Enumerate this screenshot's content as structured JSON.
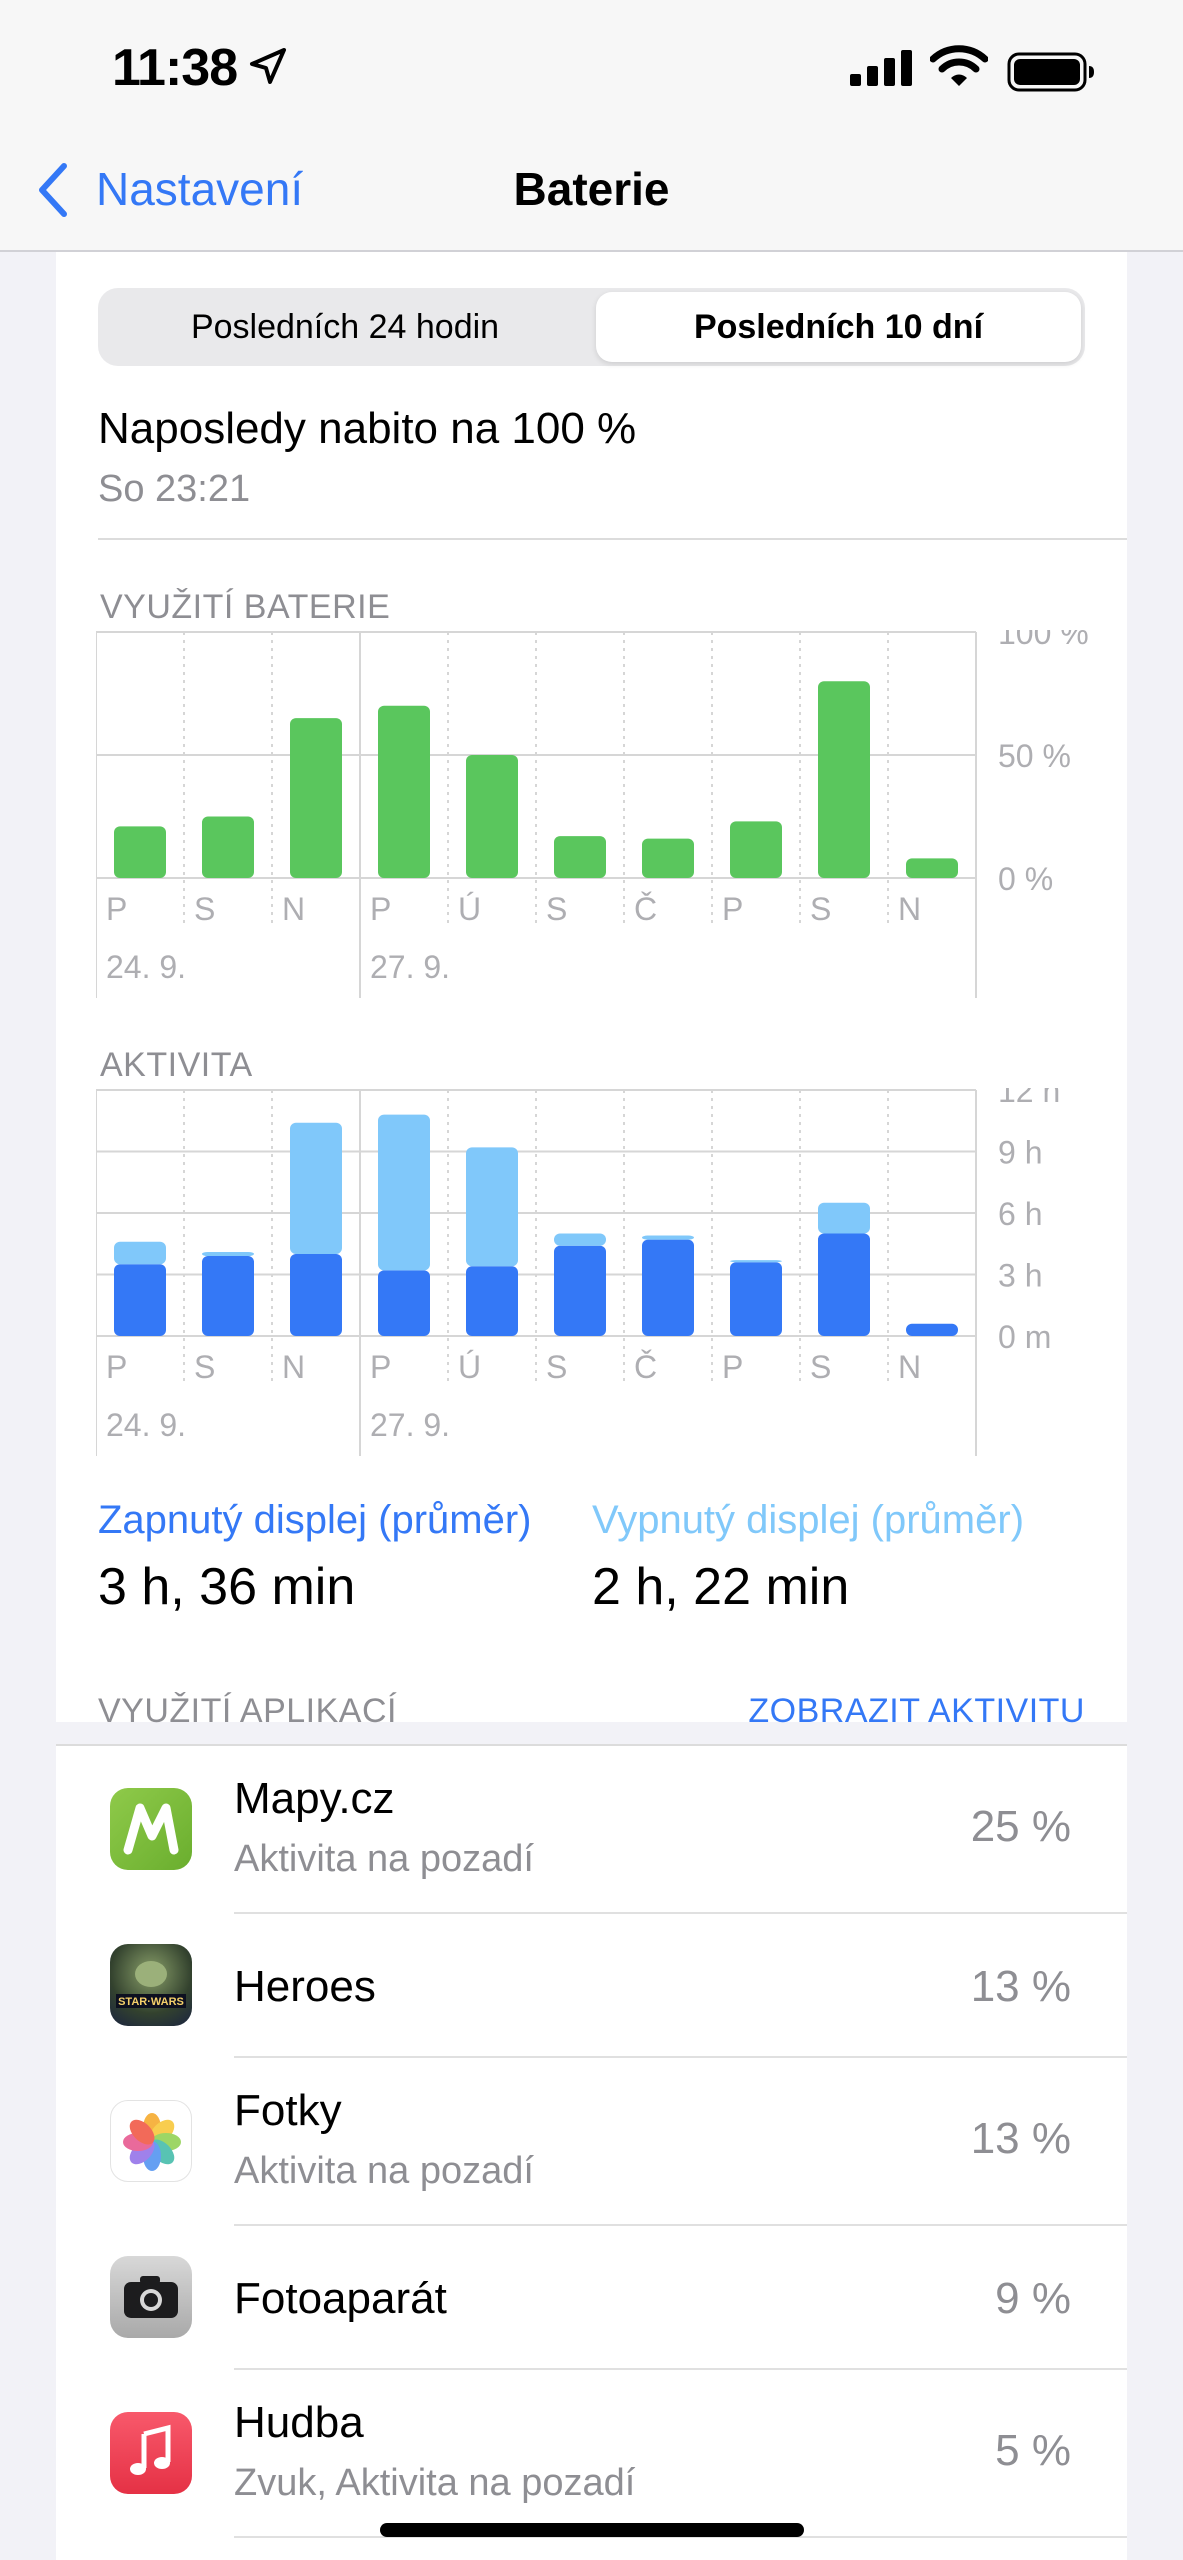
{
  "status": {
    "time": "11:38"
  },
  "nav": {
    "back_label": "Nastavení",
    "title": "Baterie"
  },
  "segmented": {
    "options": [
      "Posledních 24 hodin",
      "Posledních 10 dní"
    ],
    "selected": "Posledních 10 dní"
  },
  "last_charged": {
    "title": "Naposledy nabito na 100 %",
    "time": "So 23:21"
  },
  "chart_data": [
    {
      "type": "bar",
      "title": "VYUŽITÍ BATERIE",
      "categories": [
        "P",
        "S",
        "N",
        "P",
        "Ú",
        "S",
        "Č",
        "P",
        "S",
        "N"
      ],
      "date_labels": [
        "24. 9.",
        "27. 9."
      ],
      "y_ticks": [
        "100 %",
        "50 %",
        "0 %"
      ],
      "ylim": [
        0,
        100
      ],
      "values": [
        21,
        25,
        65,
        70,
        50,
        17,
        16,
        23,
        80,
        8
      ],
      "color": "#5ac65d",
      "grid": true
    },
    {
      "type": "bar",
      "title": "AKTIVITA",
      "categories": [
        "P",
        "S",
        "N",
        "P",
        "Ú",
        "S",
        "Č",
        "P",
        "S",
        "N"
      ],
      "date_labels": [
        "24. 9.",
        "27. 9."
      ],
      "y_ticks": [
        "12 h",
        "9 h",
        "6 h",
        "3 h",
        "0 m"
      ],
      "ylim": [
        0,
        12
      ],
      "stacked": true,
      "series": [
        {
          "values": [
            3.5,
            3.9,
            4.0,
            3.2,
            3.4,
            4.4,
            4.7,
            3.6,
            5.0,
            0.6
          ],
          "color": "#3478f6"
        },
        {
          "values": [
            1.1,
            0.2,
            6.4,
            7.6,
            5.8,
            0.6,
            0.2,
            0.1,
            1.5,
            0.0
          ],
          "color": "#80c8fa"
        }
      ],
      "grid": true
    }
  ],
  "averages": {
    "screen_on_label": "Zapnutý displej (průměr)",
    "screen_on_value": "3 h, 36 min",
    "screen_off_label": "Vypnutý displej (průměr)",
    "screen_off_value": "2 h, 22 min"
  },
  "app_usage": {
    "label": "VYUŽITÍ APLIKACÍ",
    "show_activity": "ZOBRAZIT AKTIVITU",
    "apps": [
      {
        "name": "Mapy.cz",
        "subtitle": "Aktivita na pozadí",
        "percent": "25 %",
        "icon": "mapy-cz-icon"
      },
      {
        "name": "Heroes",
        "subtitle": "",
        "percent": "13 %",
        "icon": "star-wars-heroes-icon"
      },
      {
        "name": "Fotky",
        "subtitle": "Aktivita na pozadí",
        "percent": "13 %",
        "icon": "photos-icon"
      },
      {
        "name": "Fotoaparát",
        "subtitle": "",
        "percent": "9 %",
        "icon": "camera-icon"
      },
      {
        "name": "Hudba",
        "subtitle": "Zvuk, Aktivita na pozadí",
        "percent": "5 %",
        "icon": "music-icon"
      }
    ]
  },
  "colors": {
    "accent": "#3478f6",
    "screen_off": "#80c8fa",
    "battery_bar": "#5ac65d"
  }
}
